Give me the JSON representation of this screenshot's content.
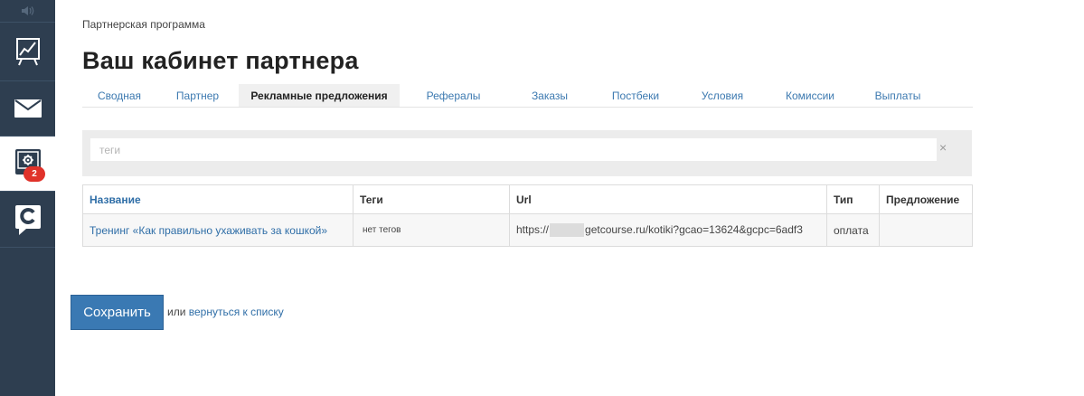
{
  "sidebar": {
    "items": [
      {
        "icon": "presentation-chart-icon"
      },
      {
        "icon": "mail-icon"
      },
      {
        "icon": "monitor-gear-icon",
        "badge": "2"
      },
      {
        "icon": "getcourse-logo-icon"
      }
    ]
  },
  "breadcrumb": "Партнерская программа",
  "page_title": "Ваш кабинет партнера",
  "tabs": [
    {
      "label": "Сводная"
    },
    {
      "label": "Партнер"
    },
    {
      "label": "Рекламные предложения",
      "active": true
    },
    {
      "label": "Рефералы"
    },
    {
      "label": "Заказы"
    },
    {
      "label": "Постбеки"
    },
    {
      "label": "Условия"
    },
    {
      "label": "Комиссии"
    },
    {
      "label": "Выплаты"
    }
  ],
  "filter": {
    "placeholder": "теги",
    "clear_label": "×"
  },
  "table": {
    "headers": {
      "name": "Название",
      "tags": "Теги",
      "url": "Url",
      "type": "Тип",
      "offer": "Предложение"
    },
    "rows": [
      {
        "name": "Тренинг «Как правильно ухаживать за кошкой»",
        "tags": "нет тегов",
        "url_prefix": "https://",
        "url_suffix": "getcourse.ru/kotiki?gcao=13624&gcpc=6adf3",
        "type": "оплата",
        "offer": ""
      }
    ]
  },
  "actions": {
    "save_label": "Сохранить",
    "or_text": "или",
    "back_link": "вернуться к списку"
  }
}
